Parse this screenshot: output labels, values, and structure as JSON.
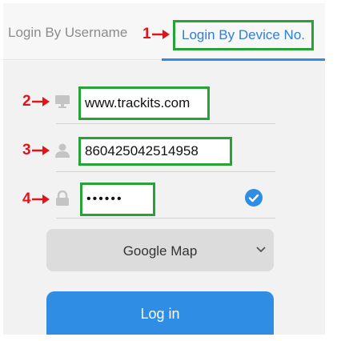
{
  "tabs": {
    "username_label": "Login By Username",
    "device_label": "Login By Device No."
  },
  "markers": [
    "1",
    "2",
    "3",
    "4"
  ],
  "fields": {
    "server": "www.trackits.com",
    "device_number": "860425042514958",
    "password": "••••••"
  },
  "map_select": {
    "selected": "Google Map"
  },
  "login_button": {
    "label": "Log in"
  },
  "colors": {
    "accent": "#2f8de4",
    "highlight_box": "#27a236",
    "marker": "#e0151c"
  },
  "icons": {
    "server": "monitor-icon",
    "device": "person-icon",
    "password": "lock-icon",
    "remember": "check-circle-icon",
    "select": "chevron-down-icon"
  }
}
